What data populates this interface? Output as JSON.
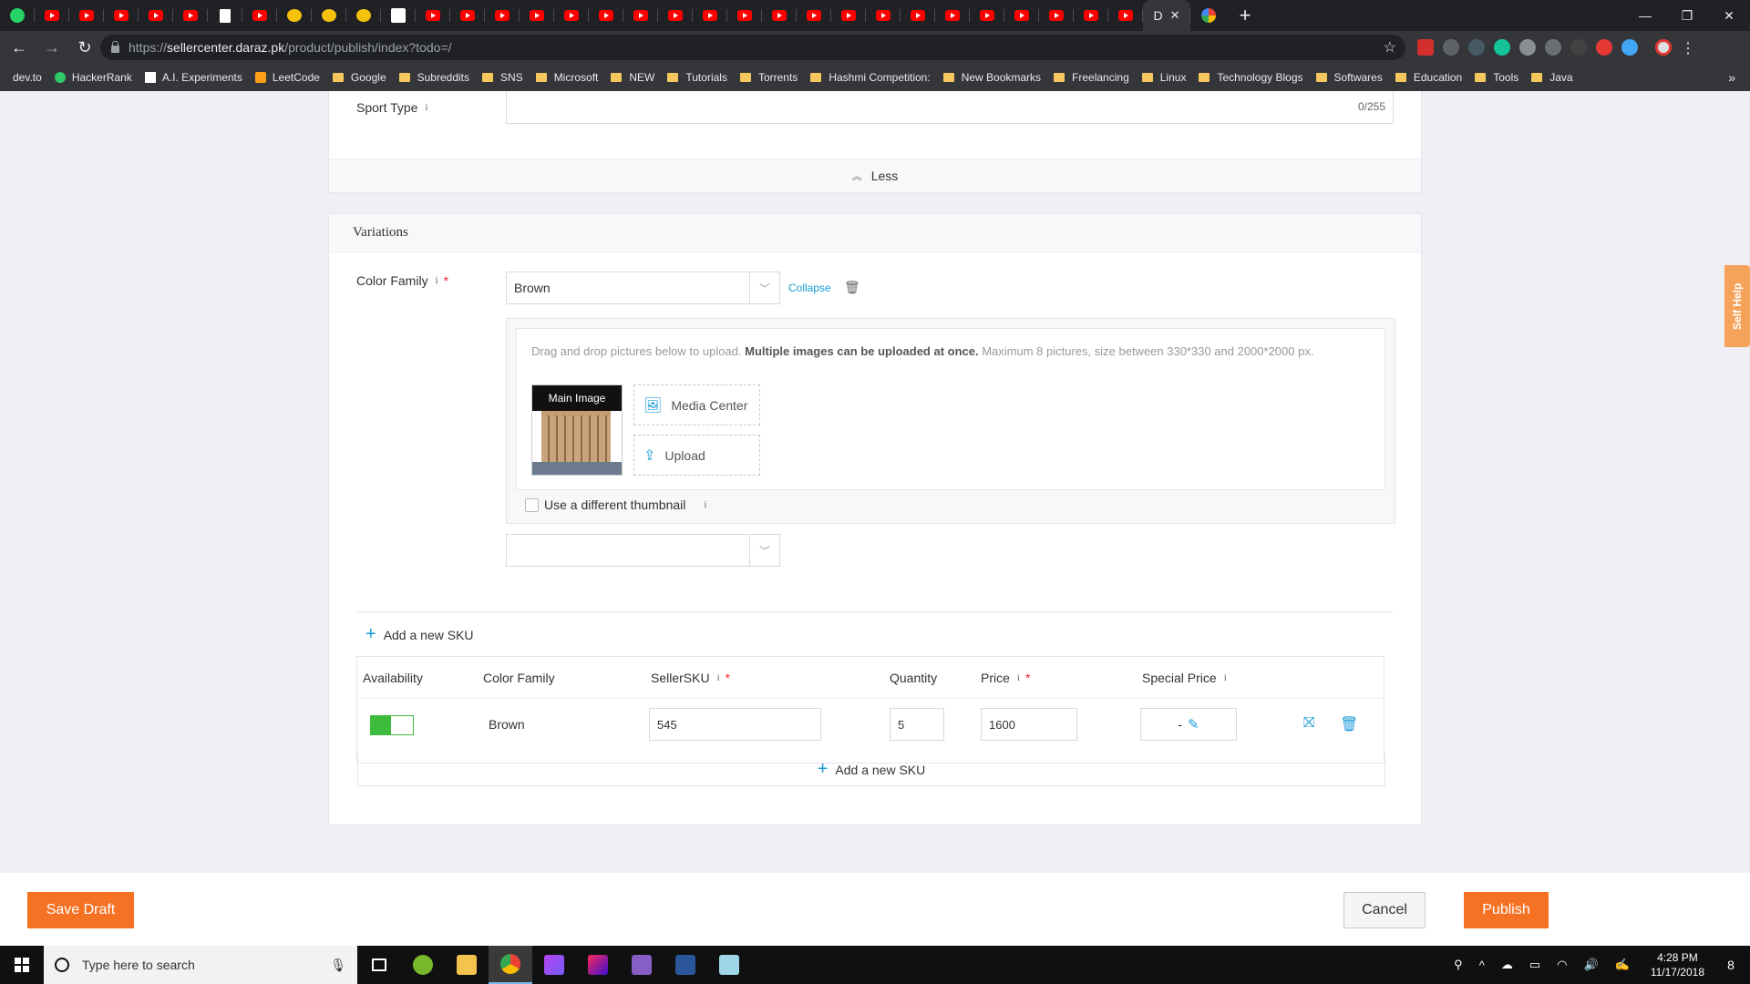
{
  "browser": {
    "active_tab_label": "D",
    "url_prefix": "https://",
    "url_host": "sellercenter.daraz.pk",
    "url_path": "/product/publish/index?todo=/",
    "bookmarks": [
      {
        "label": "dev.to",
        "icon": "page-icon"
      },
      {
        "label": "HackerRank",
        "icon": "hackerrank-icon"
      },
      {
        "label": "A.I. Experiments",
        "icon": "experiments-icon"
      },
      {
        "label": "LeetCode",
        "icon": "leetcode-icon"
      },
      {
        "label": "Google",
        "icon": "folder-icon"
      },
      {
        "label": "Subreddits",
        "icon": "folder-icon"
      },
      {
        "label": "SNS",
        "icon": "folder-icon"
      },
      {
        "label": "Microsoft",
        "icon": "folder-icon"
      },
      {
        "label": "NEW",
        "icon": "folder-icon"
      },
      {
        "label": "Tutorials",
        "icon": "folder-icon"
      },
      {
        "label": "Torrents",
        "icon": "folder-icon"
      },
      {
        "label": "Hashmi Competition:",
        "icon": "folder-icon"
      },
      {
        "label": "New Bookmarks",
        "icon": "folder-icon"
      },
      {
        "label": "Freelancing",
        "icon": "folder-icon"
      },
      {
        "label": "Linux",
        "icon": "folder-icon"
      },
      {
        "label": "Technology Blogs",
        "icon": "folder-icon"
      },
      {
        "label": "Softwares",
        "icon": "folder-icon"
      },
      {
        "label": "Education",
        "icon": "folder-icon"
      },
      {
        "label": "Tools",
        "icon": "folder-icon"
      },
      {
        "label": "Java",
        "icon": "folder-icon"
      }
    ]
  },
  "attributes": {
    "sport_type_label": "Sport Type",
    "sport_type_value": "",
    "sport_type_counter": "0/255",
    "less_label": "Less"
  },
  "variations": {
    "title": "Variations",
    "color_family_label": "Color Family",
    "color_family_value": "Brown",
    "collapse_label": "Collapse",
    "upload_hint_plain": "Drag and drop pictures below to upload. ",
    "upload_hint_bold": "Multiple images can be uploaded at once.",
    "upload_hint_rest": " Maximum 8 pictures, size between 330*330 and 2000*2000 px.",
    "main_image_label": "Main Image",
    "media_center_label": "Media Center",
    "upload_label": "Upload",
    "thumbnail_label": "Use a different thumbnail",
    "thumbnail_checked": false,
    "second_select_value": "",
    "add_sku_label": "Add a new SKU"
  },
  "sku_table": {
    "headers": {
      "availability": "Availability",
      "color_family": "Color Family",
      "seller_sku": "SellerSKU",
      "quantity": "Quantity",
      "price": "Price",
      "special_price": "Special Price"
    },
    "rows": [
      {
        "available": true,
        "color_family": "Brown",
        "seller_sku": "545",
        "quantity": "5",
        "price": "1600",
        "special_price": "-"
      }
    ],
    "add_sku_label": "Add a new SKU"
  },
  "self_help_label": "Self Help",
  "actions": {
    "save_draft": "Save Draft",
    "cancel": "Cancel",
    "publish": "Publish"
  },
  "taskbar": {
    "search_placeholder": "Type here to search",
    "time": "4:28 PM",
    "date": "11/17/2018",
    "notification_count": "8"
  },
  "colors": {
    "accent_orange": "#f57224",
    "link_blue": "#1a9cd7",
    "toggle_green": "#3dbb3d",
    "required_red": "#f5222d"
  }
}
